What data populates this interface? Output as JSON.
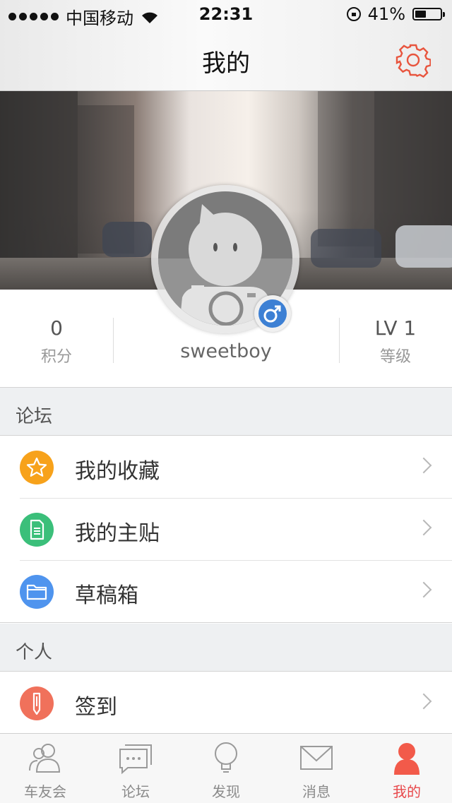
{
  "status_bar": {
    "carrier": "中国移动",
    "time": "22:31",
    "battery": "41%",
    "battery_level": 0.41
  },
  "nav": {
    "title": "我的",
    "settings_icon": "gear-icon"
  },
  "profile": {
    "points_value": "0",
    "points_label": "积分",
    "username": "sweetboy",
    "level_value": "LV 1",
    "level_label": "等级",
    "gender_icon": "male-icon"
  },
  "sections": {
    "forum": {
      "title": "论坛",
      "items": [
        {
          "label": "我的收藏",
          "icon": "star-icon",
          "color": "#f7a21b"
        },
        {
          "label": "我的主贴",
          "icon": "document-icon",
          "color": "#3bbf7a"
        },
        {
          "label": "草稿箱",
          "icon": "folder-icon",
          "color": "#4f94ee"
        }
      ]
    },
    "personal": {
      "title": "个人",
      "items": [
        {
          "label": "签到",
          "icon": "pen-icon",
          "color": "#f0715b"
        }
      ]
    }
  },
  "tabbar": {
    "tabs": [
      {
        "label": "车友会",
        "icon": "people-icon"
      },
      {
        "label": "论坛",
        "icon": "chat-icon"
      },
      {
        "label": "发现",
        "icon": "bulb-icon"
      },
      {
        "label": "消息",
        "icon": "mail-icon"
      },
      {
        "label": "我的",
        "icon": "user-icon"
      }
    ],
    "active_color": "#e8484b",
    "inactive_color": "#8a8a8a"
  }
}
